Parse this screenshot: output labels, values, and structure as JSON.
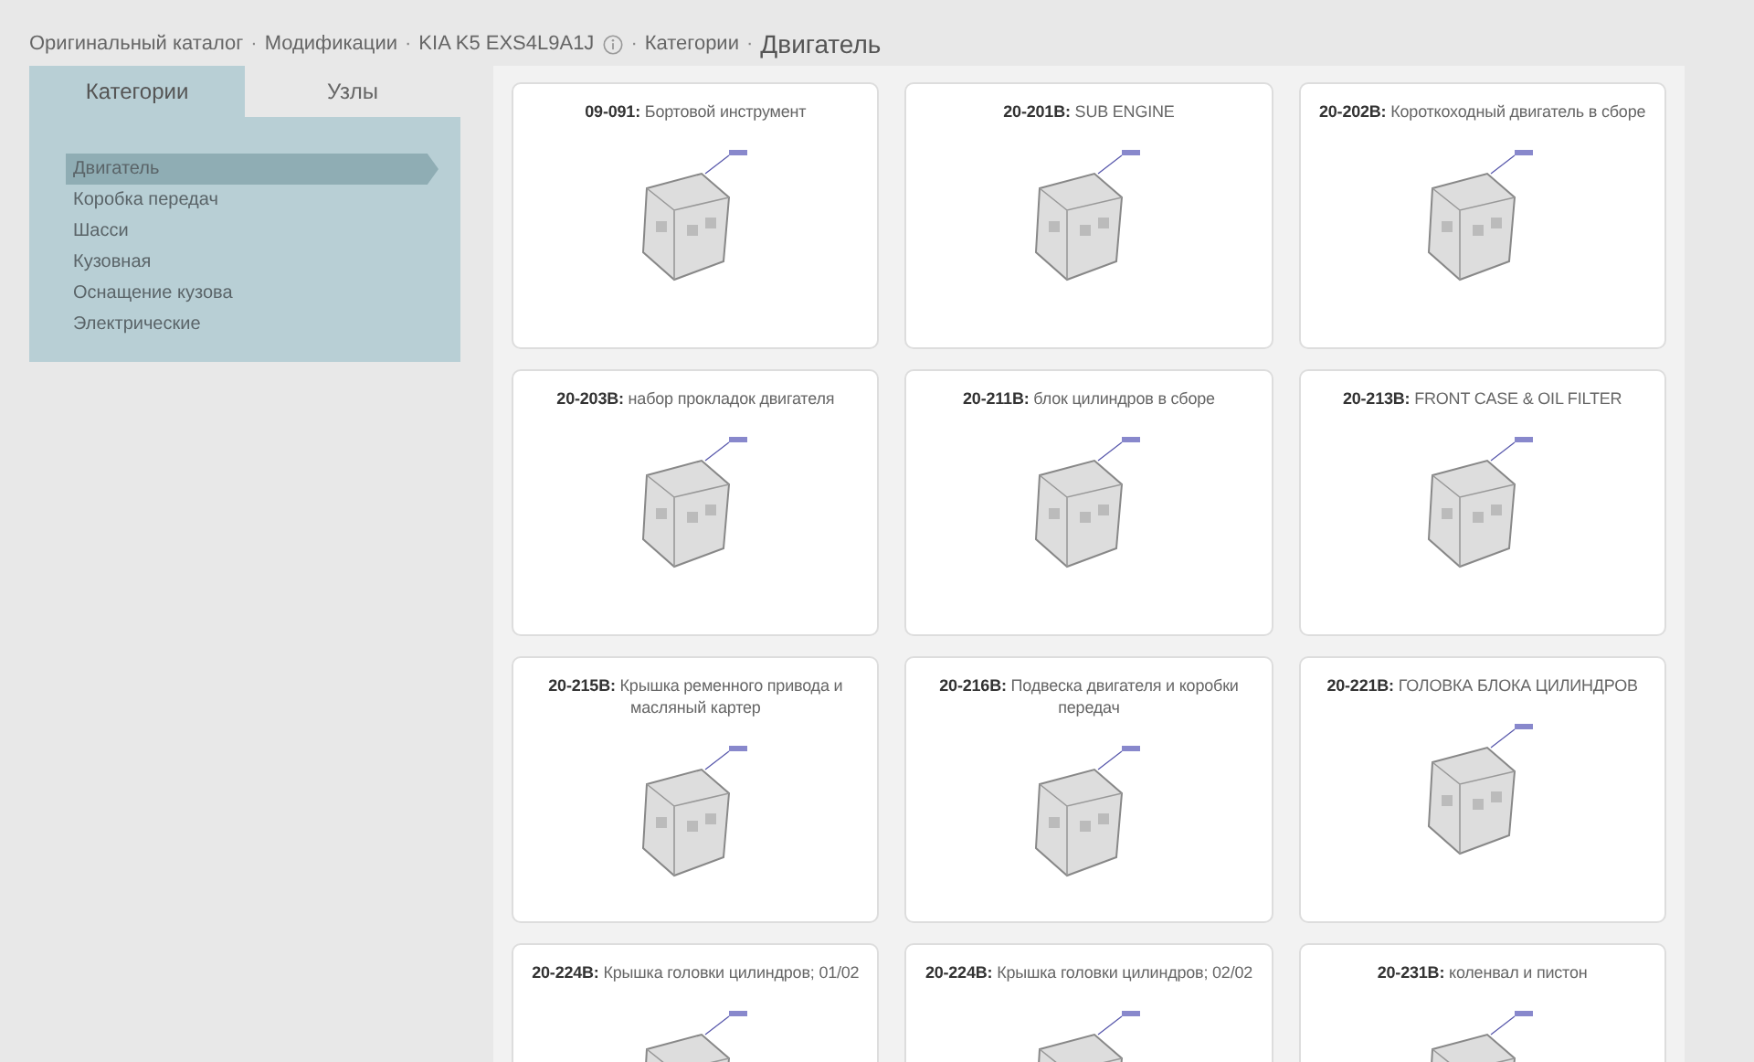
{
  "breadcrumb": {
    "separator": "·",
    "items": [
      {
        "kind": "link",
        "label": "Оригинальный каталог"
      },
      {
        "kind": "link",
        "label": "Модификации"
      },
      {
        "kind": "link",
        "label": "KIA K5 EXS4L9A1J"
      },
      {
        "kind": "info"
      },
      {
        "kind": "link",
        "label": "Категории"
      },
      {
        "kind": "current",
        "label": "Двигатель"
      }
    ]
  },
  "tabs": [
    {
      "label": "Категории",
      "selected": true
    },
    {
      "label": "Узлы",
      "selected": false
    }
  ],
  "categories": [
    {
      "label": "Двигатель",
      "selected": true
    },
    {
      "label": "Коробка передач",
      "selected": false
    },
    {
      "label": "Шасси",
      "selected": false
    },
    {
      "label": "Кузовная",
      "selected": false
    },
    {
      "label": "Оснащение кузова",
      "selected": false
    },
    {
      "label": "Электрические",
      "selected": false
    }
  ],
  "cards": [
    {
      "title": "**09-091:** Бортовой инструмент"
    },
    {
      "title": "**20-201B:** SUB ENGINE"
    },
    {
      "title": "**20-202B:** Короткоходный двигатель в сборе"
    },
    {
      "title": "**20-203B:** набор прокладок двигателя"
    },
    {
      "title": "**20-211B:** блок цилиндров в сборе"
    },
    {
      "title": "**20-213B:** FRONT CASE & OIL FILTER"
    },
    {
      "title": "**20-215B:** Крышка ременного привода и масляный картер"
    },
    {
      "title": "**20-216B:** Подвеска двигателя и коробки передач"
    },
    {
      "title": "**20-221B:** ГОЛОВКА БЛОКА ЦИЛИНДРОВ"
    },
    {
      "title": "**20-224B:** Крышка головки цилиндров; 01/02"
    },
    {
      "title": "**20-224B:** Крышка головки цилиндров; 02/02"
    },
    {
      "title": "**20-231B:** коленвал и пистон"
    }
  ]
}
